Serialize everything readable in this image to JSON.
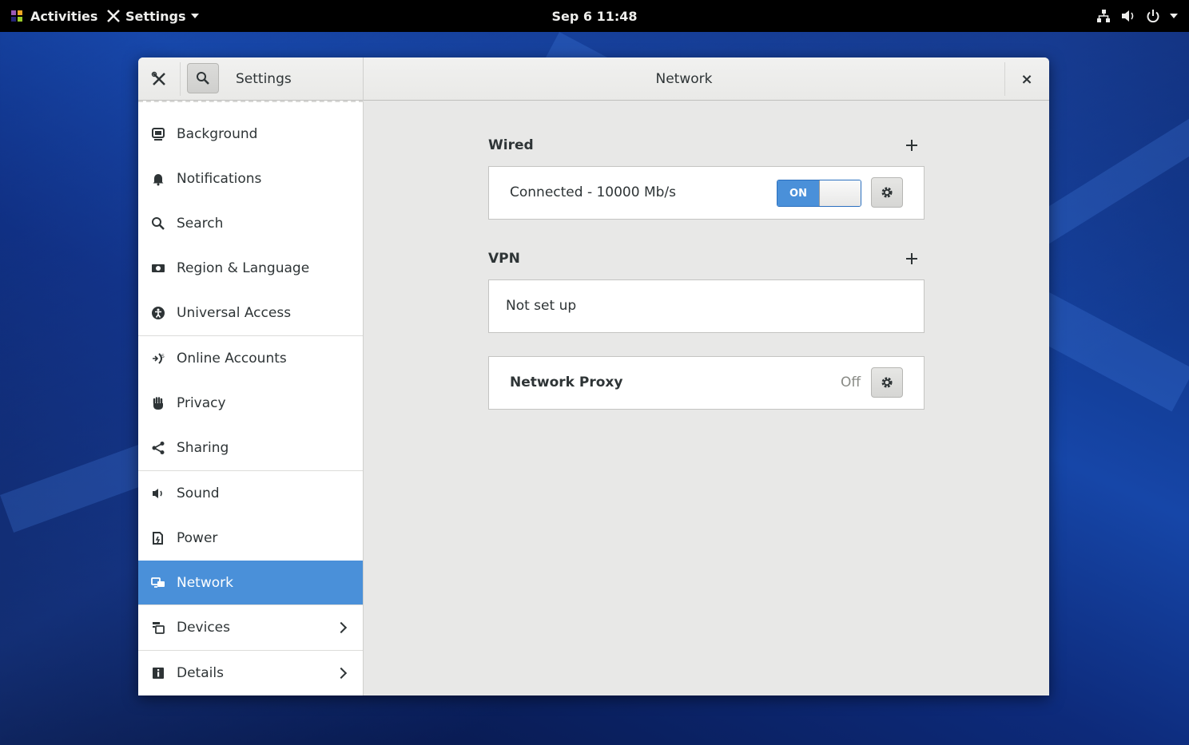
{
  "topbar": {
    "activities_label": "Activities",
    "app_menu_label": "Settings",
    "clock": "Sep 6  11:48"
  },
  "window": {
    "sidebar_title": "Settings",
    "title": "Network",
    "close_glyph": "×"
  },
  "sidebar": {
    "items": [
      {
        "label": "Background",
        "icon": "background-icon"
      },
      {
        "label": "Notifications",
        "icon": "bell-icon"
      },
      {
        "label": "Search",
        "icon": "search-icon"
      },
      {
        "label": "Region & Language",
        "icon": "region-icon"
      },
      {
        "label": "Universal Access",
        "icon": "accessibility-icon"
      },
      {
        "label": "Online Accounts",
        "icon": "online-accounts-icon"
      },
      {
        "label": "Privacy",
        "icon": "hand-icon"
      },
      {
        "label": "Sharing",
        "icon": "share-icon"
      },
      {
        "label": "Sound",
        "icon": "speaker-icon"
      },
      {
        "label": "Power",
        "icon": "power-plug-icon"
      },
      {
        "label": "Network",
        "icon": "network-icon",
        "selected": true
      },
      {
        "label": "Devices",
        "icon": "devices-icon"
      },
      {
        "label": "Details",
        "icon": "info-icon"
      }
    ]
  },
  "network": {
    "wired": {
      "title": "Wired",
      "status": "Connected - 10000 Mb/s",
      "toggle_label": "ON"
    },
    "vpn": {
      "title": "VPN",
      "status": "Not set up"
    },
    "proxy": {
      "title": "Network Proxy",
      "status": "Off"
    }
  },
  "colors": {
    "accent": "#4a90d9",
    "topbar": "#000000",
    "window_bg": "#e8e8e7"
  }
}
